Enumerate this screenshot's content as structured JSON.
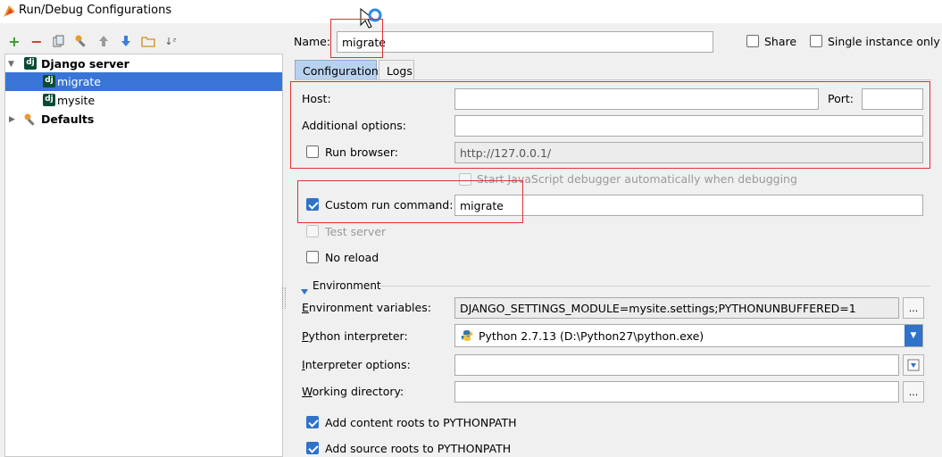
{
  "window": {
    "title": "Run/Debug Configurations"
  },
  "toolbar": {
    "icons": [
      "add-icon",
      "remove-icon",
      "copy-icon",
      "edit-defaults-icon",
      "move-up-icon",
      "move-down-icon",
      "folder-icon",
      "sort-icon"
    ]
  },
  "tree": {
    "group": "Django server",
    "items": [
      "migrate",
      "mysite"
    ],
    "defaults": "Defaults",
    "selected": "migrate",
    "icon_glyph": "dj"
  },
  "name_row": {
    "label": "Name:",
    "value": "migrate",
    "share_label": "Share",
    "share_checked": false,
    "single_instance_label": "Single instance only",
    "single_instance_checked": false
  },
  "tabs": [
    "Configuration",
    "Logs"
  ],
  "active_tab": "Configuration",
  "config": {
    "host_label": "Host:",
    "host_value": "",
    "port_label": "Port:",
    "port_value": "",
    "additional_options_label": "Additional options:",
    "additional_options_value": "",
    "run_browser_label": "Run browser:",
    "run_browser_checked": false,
    "run_browser_url": "http://127.0.0.1/",
    "js_debugger_label": "Start JavaScript debugger automatically when debugging",
    "js_debugger_checked": false,
    "custom_command_label": "Custom run command:",
    "custom_command_checked": true,
    "custom_command_value": "migrate",
    "test_server_label": "Test server",
    "test_server_checked": false,
    "no_reload_label": "No reload",
    "no_reload_checked": false
  },
  "environment": {
    "section_label": "Environment",
    "env_vars_label": "Environment variables:",
    "env_vars_value": "DJANGO_SETTINGS_MODULE=mysite.settings;PYTHONUNBUFFERED=1",
    "interpreter_label": "Python interpreter:",
    "interpreter_value": "Python 2.7.13 (D:\\Python27\\python.exe)",
    "interpreter_options_label": "Interpreter options:",
    "interpreter_options_value": "",
    "working_dir_label": "Working directory:",
    "working_dir_value": "",
    "content_roots_label": "Add content roots to PYTHONPATH",
    "content_roots_checked": true,
    "source_roots_label": "Add source roots to PYTHONPATH",
    "source_roots_checked": true,
    "browse_label": "...",
    "dropdown_glyph": "▼"
  },
  "colors": {
    "selection": "#3875d7",
    "annotation_red": "#e03030",
    "checkbox_blue": "#2f72c9",
    "django_green": "#0c4b33"
  }
}
